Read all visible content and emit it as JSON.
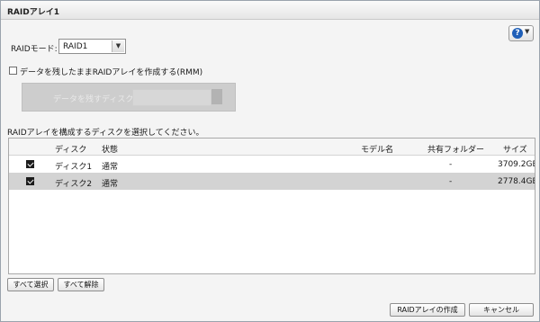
{
  "dialog": {
    "title": "RAIDアレイ1"
  },
  "raid_mode": {
    "label": "RAIDモード:",
    "value": "RAID1"
  },
  "keep_data": {
    "label": "データを残したままRAIDアレイを作成する(RMM)",
    "checked": false
  },
  "keep_disk": {
    "label": "データを残すディスク:"
  },
  "select_disks_label": "RAIDアレイを構成するディスクを選択してください。",
  "table": {
    "columns": [
      "ディスク",
      "状態",
      "モデル名",
      "共有フォルダー",
      "サイズ"
    ],
    "rows": [
      {
        "checked": true,
        "disk": "ディスク1",
        "status": "通常",
        "model": "",
        "share": "-",
        "size": "3709.2GB",
        "selected": false
      },
      {
        "checked": true,
        "disk": "ディスク2",
        "status": "通常",
        "model": "",
        "share": "-",
        "size": "2778.4GB",
        "selected": true
      }
    ]
  },
  "buttons": {
    "select_all": "すべて選択",
    "deselect_all": "すべて解除",
    "create": "RAIDアレイの作成",
    "cancel": "キャンセル"
  }
}
